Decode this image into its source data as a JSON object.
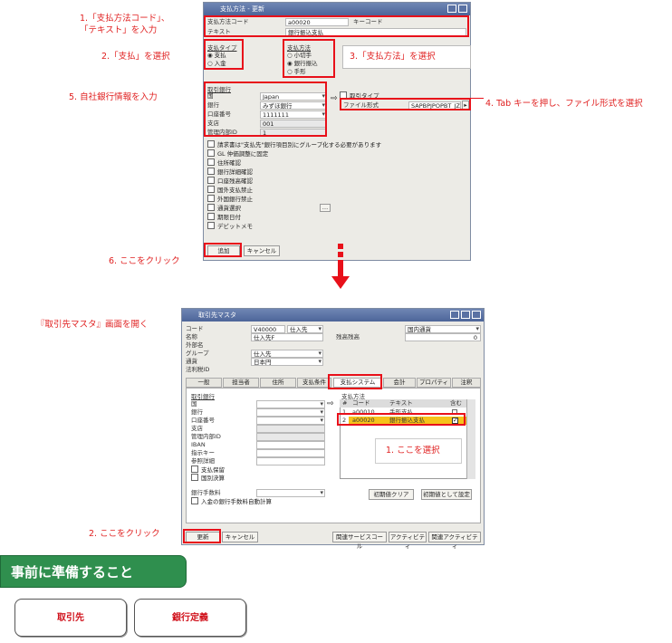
{
  "annotations": {
    "a1": "1.「支払方法コード」、\n「テキスト」を入力",
    "a2": "2.「支払」を選択",
    "a3": "3.「支払方法」を選択",
    "a4": "4. Tab キーを押し、ファイル形式を選択",
    "a5": "5. 自社銀行情報を入力",
    "a6": "6. ここをクリック",
    "open_bp": "『取引先マスタ』画面を開く",
    "b1": "1. ここを選択",
    "b2": "2. ここをクリック"
  },
  "pm_window": {
    "title": "支払方法 - 更新",
    "code_label": "支払方法コード",
    "code_value": "a00020",
    "key_label": "キーコード",
    "text_label": "テキスト",
    "text_value": "銀行振込支払",
    "type_group": "支払タイプ",
    "type_options": [
      "支払",
      "入金"
    ],
    "method_group": "支払方法",
    "method_options": [
      "小切手",
      "銀行振込",
      "手形"
    ],
    "bank_group": "取引銀行",
    "country_label": "国",
    "country_value": "Japan",
    "bank_label": "銀行",
    "bank_value": "みずほ銀行",
    "account_label": "口座番号",
    "account_value": "1111111",
    "branch_label": "支店",
    "branch_value": "001",
    "mgmt_label": "管理内部ID",
    "mgmt_value": "1",
    "doc_type_label": "取引タイプ",
    "file_format_label": "ファイル形式",
    "file_format_value": "SAPBPJPOPBT_JZ",
    "checkboxes": [
      "請求書は\"支払先\"銀行項目別にグループ化する必要があります",
      "GL 仲価調整に固定",
      "住所確認",
      "銀行詳細確認",
      "口座残高確認",
      "国外支払禁止",
      "外国銀行禁止",
      "通貨選択",
      "期限日付",
      "デビットメモ"
    ],
    "add_button": "追加",
    "cancel_button": "キャンセル"
  },
  "bp_window": {
    "title": "取引先マスタ",
    "code_label": "コード",
    "code_value": "V40000",
    "type_value": "仕入先",
    "country_right": "国内通貨",
    "name_label": "名称",
    "name_value": "仕入先F",
    "balance_label": "残高残高",
    "balance_value": "0",
    "foreign_label": "外部名",
    "group_label": "グループ",
    "group_value": "仕入先",
    "currency_label": "通貨",
    "currency_value": "日本円",
    "taxid_label": "法利税ID",
    "tabs": [
      "一般",
      "担当者",
      "住所",
      "支払条件",
      "支払システム",
      "会計",
      "プロパティ",
      "注釈"
    ],
    "left_section": "取引銀行",
    "left_labels": [
      "国",
      "銀行",
      "口座番号",
      "支店",
      "管理内部ID",
      "IBAN",
      "指示キー",
      "参照詳細"
    ],
    "left_checks": [
      "支払保留",
      "国別決算"
    ],
    "fee_label": "銀行手数料",
    "fee_check": "入金の銀行手数料自動計算",
    "pm_section": "支払方法",
    "table_headers": [
      "#",
      "コード",
      "テキスト",
      "含む"
    ],
    "rows": [
      {
        "num": "1",
        "code": "a00010",
        "text": "手形支払"
      },
      {
        "num": "2",
        "code": "a00020",
        "text": "銀行振込支払"
      }
    ],
    "clear_btn": "初期値クリア",
    "default_btn": "初期値として設定",
    "update_btn": "更新",
    "cancel_btn": "キャンセル",
    "service_btn": "関連サービスコール",
    "activity_btn": "アクティビティ",
    "related_btn": "関連アクティビティ"
  },
  "banner": "事前に準備すること",
  "buttons": [
    "取引先",
    "銀行定義"
  ]
}
